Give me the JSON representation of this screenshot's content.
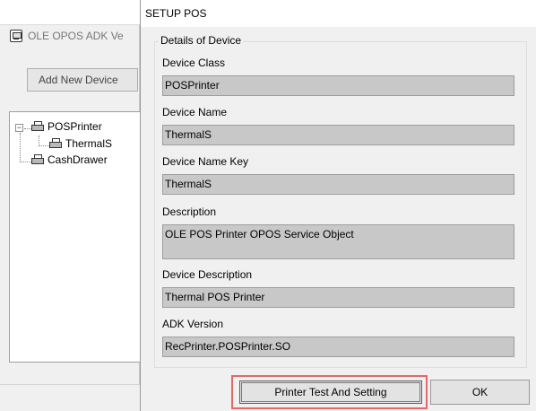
{
  "background_window": {
    "title": "OLE OPOS ADK Ve",
    "add_device_label": "Add New Device",
    "tree": {
      "root_label": "POSPrinter",
      "child_label": "ThermalS",
      "sibling_label": "CashDrawer",
      "root_expander": "−"
    }
  },
  "dialog": {
    "title": "SETUP POS",
    "group_label": "Details of Device",
    "fields": {
      "device_class": {
        "label": "Device Class",
        "value": "POSPrinter"
      },
      "device_name": {
        "label": "Device Name",
        "value": "ThermalS"
      },
      "device_name_key": {
        "label": "Device Name Key",
        "value": "ThermalS"
      },
      "description": {
        "label": "Description",
        "value": "OLE POS Printer OPOS Service Object"
      },
      "device_description": {
        "label": "Device Description",
        "value": "Thermal POS Printer"
      },
      "adk_version": {
        "label": "ADK Version",
        "value": "RecPrinter.POSPrinter.SO"
      }
    },
    "buttons": {
      "printer_test": "Printer Test And Setting",
      "ok": "OK"
    }
  },
  "colors": {
    "highlight": "#e06a6a",
    "field_background": "#c8c8c8",
    "window_background": "#f0f0f0"
  }
}
